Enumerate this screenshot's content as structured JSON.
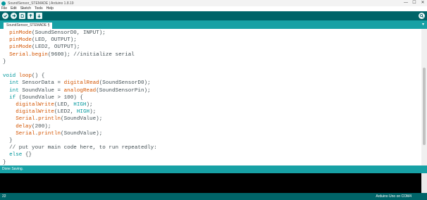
{
  "window": {
    "title": "SoundSensor_STEMADE | Arduino 1.8.19",
    "minimize": "—",
    "maximize": "☐",
    "close": "✕"
  },
  "menu": [
    "File",
    "Edit",
    "Sketch",
    "Tools",
    "Help"
  ],
  "toolbar": {
    "buttons": [
      "verify-button",
      "upload-button",
      "new-button",
      "open-button",
      "save-button"
    ],
    "serial_monitor": "serial-monitor-button"
  },
  "tab": {
    "label": "SoundSensor_STEMADE §",
    "menu": "▾"
  },
  "code": [
    [
      [
        "  ",
        "p"
      ],
      [
        "pinMode",
        "fn"
      ],
      [
        "(SoundSensorD0, INPUT);",
        "p"
      ]
    ],
    [
      [
        "  ",
        "p"
      ],
      [
        "pinMode",
        "fn"
      ],
      [
        "(LED, OUTPUT);",
        "p"
      ]
    ],
    [
      [
        "  ",
        "p"
      ],
      [
        "pinMode",
        "fn"
      ],
      [
        "(LED2, OUTPUT);",
        "p"
      ]
    ],
    [
      [
        "  ",
        "p"
      ],
      [
        "Serial",
        "fn"
      ],
      [
        ".",
        "p"
      ],
      [
        "begin",
        "fn"
      ],
      [
        "(9600); //initialize serial",
        "p"
      ]
    ],
    [
      [
        "}",
        "p"
      ]
    ],
    [
      [
        "",
        "p"
      ]
    ],
    [
      [
        "void",
        "kw"
      ],
      [
        " ",
        "p"
      ],
      [
        "loop",
        "fn"
      ],
      [
        "() {",
        "p"
      ]
    ],
    [
      [
        "  ",
        "p"
      ],
      [
        "int",
        "kw"
      ],
      [
        " SensorData = ",
        "p"
      ],
      [
        "digitalRead",
        "fn"
      ],
      [
        "(SoundSensorD0);",
        "p"
      ]
    ],
    [
      [
        "  ",
        "p"
      ],
      [
        "int",
        "kw"
      ],
      [
        " SoundValue = ",
        "p"
      ],
      [
        "analogRead",
        "fn"
      ],
      [
        "(SoundSensorPin);",
        "p"
      ]
    ],
    [
      [
        "  ",
        "p"
      ],
      [
        "if",
        "kw"
      ],
      [
        " (SoundValue > 100) {",
        "p"
      ]
    ],
    [
      [
        "    ",
        "p"
      ],
      [
        "digitalWrite",
        "fn"
      ],
      [
        "(LED, ",
        "p"
      ],
      [
        "HIGH",
        "kw"
      ],
      [
        ");",
        "p"
      ]
    ],
    [
      [
        "    ",
        "p"
      ],
      [
        "digitalWrite",
        "fn"
      ],
      [
        "(LED2, ",
        "p"
      ],
      [
        "HIGH",
        "kw"
      ],
      [
        ");",
        "p"
      ]
    ],
    [
      [
        "    ",
        "p"
      ],
      [
        "Serial",
        "fn"
      ],
      [
        ".",
        "p"
      ],
      [
        "println",
        "fn"
      ],
      [
        "(SoundValue);",
        "p"
      ]
    ],
    [
      [
        "    ",
        "p"
      ],
      [
        "delay",
        "fn"
      ],
      [
        "(200);",
        "p"
      ]
    ],
    [
      [
        "    ",
        "p"
      ],
      [
        "Serial",
        "fn"
      ],
      [
        ".",
        "p"
      ],
      [
        "println",
        "fn"
      ],
      [
        "(SoundValue);",
        "p"
      ]
    ],
    [
      [
        "  }",
        "p"
      ]
    ],
    [
      [
        "  // put your main code here, to run repeatedly:",
        "p"
      ]
    ],
    [
      [
        "  ",
        "p"
      ],
      [
        "else",
        "kw"
      ],
      [
        " {}",
        "p"
      ]
    ],
    [
      [
        "}",
        "p"
      ]
    ]
  ],
  "status": {
    "message": "Done Saving."
  },
  "footer": {
    "line": "22",
    "board": "Arduino Uno on COM4"
  },
  "colors": {
    "toolbar": "#006468",
    "tab_strip": "#17a1a5",
    "keyword": "#00979c",
    "function": "#d35400"
  }
}
